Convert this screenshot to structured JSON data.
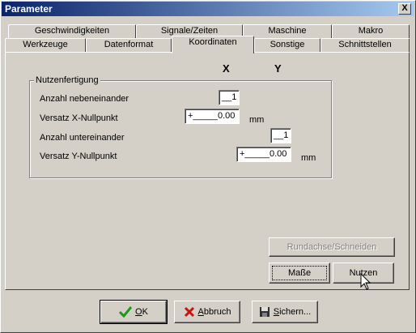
{
  "window": {
    "title": "Parameter",
    "close_glyph": "X"
  },
  "tabs_row1": [
    "Geschwindigkeiten",
    "Signale/Zeiten",
    "Maschine",
    "Makro"
  ],
  "tabs_row2": [
    "Werkzeuge",
    "Datenformat",
    "Koordinaten",
    "Sonstige",
    "Schnittstellen"
  ],
  "active_tab": "Koordinaten",
  "columns": {
    "x": "X",
    "y": "Y"
  },
  "group": {
    "title": "Nutzenfertigung",
    "rows": [
      {
        "label": "Anzahl nebeneinander",
        "value": "__1"
      },
      {
        "label": "Versatz X-Nullpunkt",
        "value": "+_____0.00",
        "unit": "mm"
      },
      {
        "label": "Anzahl untereinander",
        "value": "__1"
      },
      {
        "label": "Versatz Y-Nullpunkt",
        "value": "+_____0.00",
        "unit": "mm"
      }
    ]
  },
  "buttons": {
    "rundachse": "Rundachse/Schneiden",
    "masse": "Maße",
    "nutzen": "Nutzen"
  },
  "footer": {
    "ok_hotkey": "O",
    "ok_rest": "K",
    "cancel_hotkey": "A",
    "cancel_rest": "bbruch",
    "save_hotkey": "S",
    "save_rest": "ichern..."
  },
  "colors": {
    "title_start": "#0a246a",
    "title_end": "#a6caf0",
    "ok_icon": "#1a9a1a",
    "cancel_icon": "#cc1111"
  },
  "icons": {
    "ok": "checkmark-icon",
    "cancel": "x-icon",
    "save": "floppy-disk-icon",
    "close": "close-icon"
  }
}
